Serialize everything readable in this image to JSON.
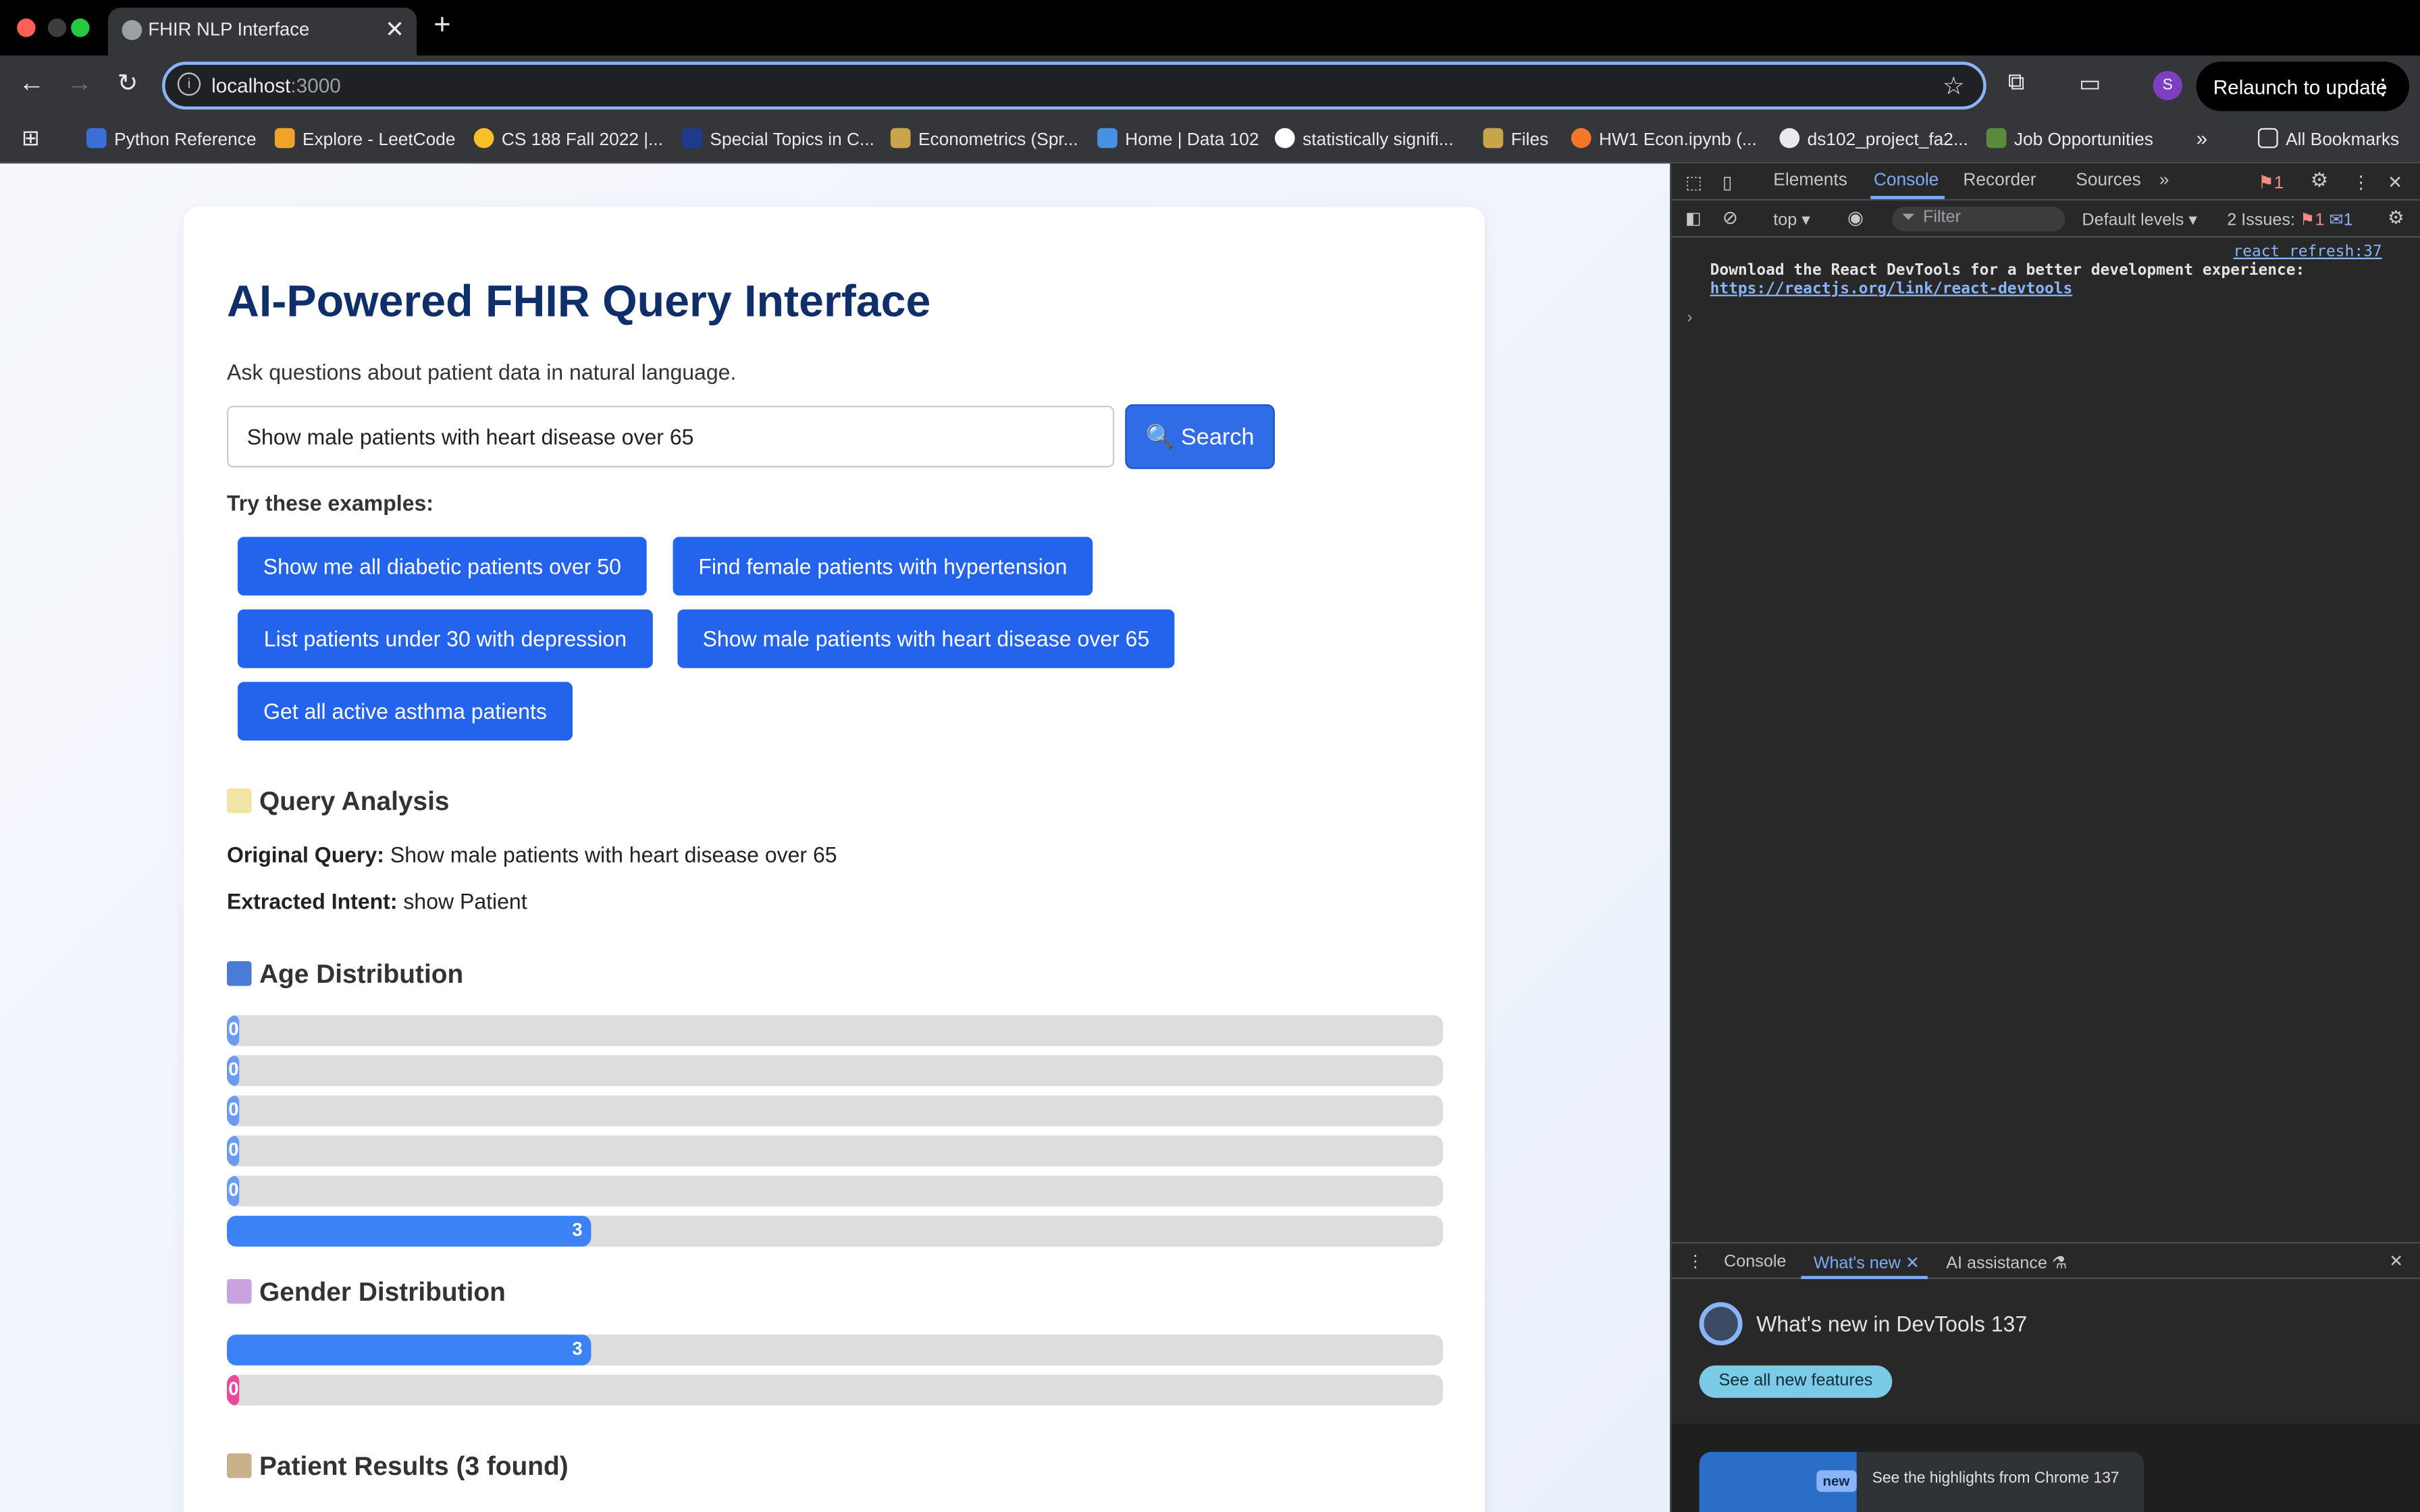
{
  "browser": {
    "tab_title": "FHIR NLP Interface",
    "url_host": "localhost",
    "url_port": ":3000",
    "relaunch_label": "Relaunch to update",
    "profile_initial": "S",
    "bookmarks": [
      {
        "label": "Python Reference",
        "color": "#3b6fd8"
      },
      {
        "label": "Explore - LeetCode",
        "color": "#f0a32b"
      },
      {
        "label": "CS 188 Fall 2022 |...",
        "color": "#f6c026"
      },
      {
        "label": "Special Topics in C...",
        "color": "#1e3a8a"
      },
      {
        "label": "Econometrics (Spr...",
        "color": "#c8a44b"
      },
      {
        "label": "Home | Data 102",
        "color": "#4a90e2"
      },
      {
        "label": "statistically signifi...",
        "color": "#ffffff"
      },
      {
        "label": "Files",
        "color": "#c8a44b"
      },
      {
        "label": "HW1 Econ.ipynb (...",
        "color": "#f37726"
      },
      {
        "label": "ds102_project_fa2...",
        "color": "#e8eaed"
      },
      {
        "label": "Job Opportunities",
        "color": "#5a8a3c"
      }
    ],
    "all_bookmarks_label": "All Bookmarks"
  },
  "app": {
    "title": "AI-Powered FHIR Query Interface",
    "subtitle": "Ask questions about patient data in natural language.",
    "query_value": "Show male patients with heart disease over 65",
    "search_label": "🔍 Search",
    "examples_heading": "Try these examples:",
    "examples": [
      "Show me all diabetic patients over 50",
      "Find female patients with hypertension",
      "List patients under 30 with depression",
      "Show male patients with heart disease over 65",
      "Get all active asthma patients"
    ],
    "analysis": {
      "heading": "Query Analysis",
      "original_label": "Original Query:",
      "original_value": "Show male patients with heart disease over 65",
      "intent_label": "Extracted Intent:",
      "intent_value": "show Patient"
    },
    "age_distribution": {
      "heading": "Age Distribution",
      "values": [
        0,
        0,
        0,
        0,
        0,
        3
      ],
      "max": 10,
      "color": "#6c9bf2",
      "last_color": "#3b82f6"
    },
    "gender_distribution": {
      "heading": "Gender Distribution",
      "values": [
        3,
        0
      ],
      "max": 10,
      "colors": [
        "#3b82f6",
        "#ec4899"
      ]
    },
    "results_heading": "Patient Results (3 found)",
    "colors": {
      "primary_button": "#2463eb",
      "title": "#0f2f6b"
    }
  },
  "devtools": {
    "tabs": [
      "Elements",
      "Console",
      "Recorder",
      "Sources"
    ],
    "active_tab": "Console",
    "error_count": "1",
    "context": "top",
    "filter_placeholder": "Filter",
    "levels": "Default levels",
    "issues_label": "2 Issues:",
    "issues_error": "1",
    "issues_info": "1",
    "source_link": "react refresh:37",
    "message": "Download the React DevTools for a better development experience:",
    "message_link": "https://reactjs.org/link/react-devtools",
    "prompt": "›",
    "drawer_tabs": [
      "Console",
      "What's new",
      "AI assistance"
    ],
    "whats_new_title": "What's new in DevTools 137",
    "see_all_label": "See all new features",
    "new_badge": "new",
    "highlights_text": "See the highlights from Chrome 137"
  }
}
